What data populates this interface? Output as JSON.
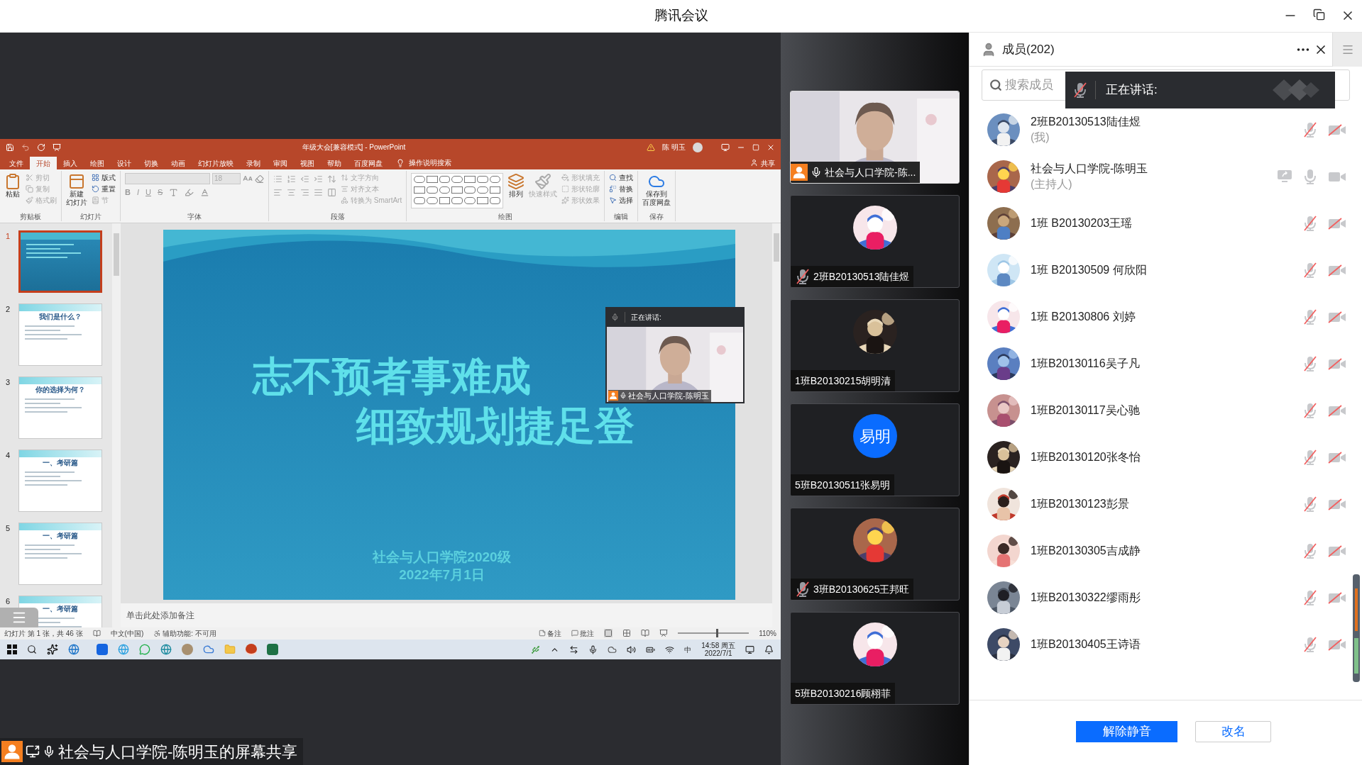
{
  "window": {
    "title": "腾讯会议"
  },
  "shared_screen": {
    "app_title": "年级大会[兼容模式] - PowerPoint",
    "user_name": "陈 明玉",
    "tabs": [
      {
        "label": "文件",
        "selected": false
      },
      {
        "label": "开始",
        "selected": true
      },
      {
        "label": "插入",
        "selected": false
      },
      {
        "label": "绘图",
        "selected": false
      },
      {
        "label": "设计",
        "selected": false
      },
      {
        "label": "切换",
        "selected": false
      },
      {
        "label": "动画",
        "selected": false
      },
      {
        "label": "幻灯片放映",
        "selected": false
      },
      {
        "label": "录制",
        "selected": false
      },
      {
        "label": "审阅",
        "selected": false
      },
      {
        "label": "视图",
        "selected": false
      },
      {
        "label": "帮助",
        "selected": false
      },
      {
        "label": "百度网盘",
        "selected": false
      }
    ],
    "tell_me": "操作说明搜索",
    "share_button": "共享",
    "ribbon_groups": [
      {
        "kind": "clipboard",
        "label": "剪贴板",
        "large": [
          {
            "label_lines": [
              "粘贴"
            ],
            "disabled": false
          }
        ],
        "small": [
          {
            "label": "剪切",
            "disabled": true
          },
          {
            "label": "复制",
            "disabled": true
          },
          {
            "label": "格式刷",
            "disabled": true
          }
        ]
      },
      {
        "kind": "slides",
        "label": "幻灯片",
        "large": [
          {
            "label_lines": [
              "新建",
              "幻灯片"
            ],
            "disabled": false
          }
        ],
        "small": [
          {
            "label": "版式",
            "disabled": false
          },
          {
            "label": "重置",
            "disabled": false
          },
          {
            "label": "节",
            "disabled": true
          }
        ]
      },
      {
        "kind": "font",
        "label": "字体",
        "font_size": "18",
        "format_buttons": [
          "B",
          "I",
          "U",
          "S"
        ]
      },
      {
        "kind": "paragraph",
        "label": "段落",
        "small": [
          {
            "label": "文字方向",
            "disabled": true
          },
          {
            "label": "对齐文本",
            "disabled": true
          },
          {
            "label": "转换为 SmartArt",
            "disabled": true
          }
        ]
      },
      {
        "kind": "drawing",
        "label": "绘图",
        "large": [
          {
            "label_lines": [
              "排列"
            ],
            "disabled": false
          },
          {
            "label_lines": [
              "快速样式"
            ],
            "disabled": true
          }
        ],
        "small": [
          {
            "label": "形状填充",
            "disabled": true
          },
          {
            "label": "形状轮廓",
            "disabled": true
          },
          {
            "label": "形状效果",
            "disabled": true
          }
        ]
      },
      {
        "kind": "editing",
        "label": "编辑",
        "small": [
          {
            "label": "查找",
            "disabled": false
          },
          {
            "label": "替换",
            "disabled": false
          },
          {
            "label": "选择",
            "disabled": false
          }
        ]
      },
      {
        "kind": "save",
        "label": "保存",
        "large": [
          {
            "label_lines": [
              "保存到",
              "百度网盘"
            ],
            "disabled": false
          }
        ]
      }
    ],
    "thumbnails": [
      {
        "number": "1",
        "selected": true
      },
      {
        "number": "2",
        "title": "我们是什么？",
        "selected": false
      },
      {
        "number": "3",
        "title": "你的选择为何？",
        "selected": false
      },
      {
        "number": "4",
        "title": "一、考研篇",
        "selected": false
      },
      {
        "number": "5",
        "title": "一、考研篇",
        "selected": false
      },
      {
        "number": "6",
        "title": "一、考研篇",
        "selected": false
      }
    ],
    "slide": {
      "title_lines": [
        "志不预者事难成",
        "细致规划捷足登"
      ],
      "subtitle_lines": [
        "社会与人口学院2020级",
        "2022年7月1日"
      ]
    },
    "speaker_popup": {
      "label": "正在讲话:",
      "name": "社会与人口学院-陈明玉"
    },
    "notes_placeholder": "单击此处添加备注",
    "status": {
      "slide_count": "幻灯片 第 1 张，共 46 张",
      "language": "中文(中国)",
      "accessibility": "辅助功能: 不可用",
      "notes": "备注",
      "comments": "批注",
      "zoom": {
        "text": "110%",
        "level": 0.55
      }
    },
    "taskbar": {
      "ime": "中",
      "time": "14:58 周五",
      "date": "2022/7/1"
    }
  },
  "share_label": "社会与人口学院-陈明玉的屏幕共享",
  "video_tiles": [
    {
      "kind": "video",
      "name": "社会与人口学院-陈...",
      "host": true,
      "mic_muted": false
    },
    {
      "kind": "avatar",
      "name": "2班B20130513陆佳煜",
      "host": false,
      "mic_muted": true
    },
    {
      "kind": "avatar",
      "name": "1班B20130215胡明清",
      "host": false
    },
    {
      "kind": "initials",
      "initials": "易明",
      "name": "5班B20130511张易明",
      "host": false
    },
    {
      "kind": "avatar",
      "name": "3班B20130625王邦旺",
      "host": false,
      "mic_muted": true
    },
    {
      "kind": "avatar",
      "name": "5班B20130216顾栩菲",
      "host": false
    }
  ],
  "panel": {
    "title": "成员(202)",
    "search_placeholder": "搜索成员",
    "speaking_label": "正在讲话:",
    "members": [
      {
        "name": "2班B20130513陆佳煜",
        "note": "(我)",
        "sharing": false,
        "mic_muted": true,
        "camera_off": true
      },
      {
        "name": "社会与人口学院-陈明玉",
        "note": "(主持人)",
        "sharing": true,
        "mic_muted": false,
        "camera_off": false
      },
      {
        "name": "1班 B20130203王瑶",
        "sharing": false,
        "mic_muted": true,
        "camera_off": true
      },
      {
        "name": "1班 B20130509 何欣阳",
        "sharing": false,
        "mic_muted": true,
        "camera_off": true
      },
      {
        "name": "1班 B20130806 刘婷",
        "sharing": false,
        "mic_muted": true,
        "camera_off": true
      },
      {
        "name": "1班B20130116吴子凡",
        "sharing": false,
        "mic_muted": true,
        "camera_off": true
      },
      {
        "name": "1班B20130117吴心驰",
        "sharing": false,
        "mic_muted": true,
        "camera_off": true
      },
      {
        "name": "1班B20130120张冬怡",
        "sharing": false,
        "mic_muted": true,
        "camera_off": true
      },
      {
        "name": "1班B20130123彭景",
        "sharing": false,
        "mic_muted": true,
        "camera_off": true
      },
      {
        "name": "1班B20130305吉成静",
        "sharing": false,
        "mic_muted": true,
        "camera_off": true
      },
      {
        "name": "1班B20130322缪雨彤",
        "sharing": false,
        "mic_muted": true,
        "camera_off": true
      },
      {
        "name": "1班B20130405王诗语",
        "sharing": false,
        "mic_muted": true,
        "camera_off": true
      }
    ],
    "buttons": [
      {
        "label": "解除静音",
        "primary": true
      },
      {
        "label": "改名",
        "primary": false
      }
    ]
  }
}
